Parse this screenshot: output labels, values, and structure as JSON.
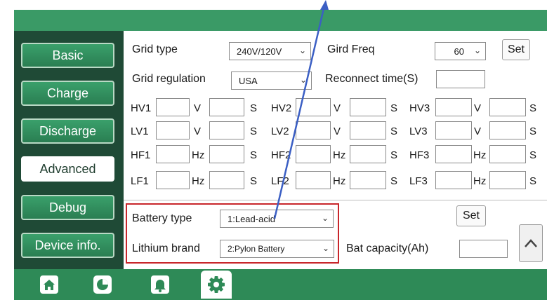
{
  "sidebar": {
    "items": [
      {
        "label": "Basic"
      },
      {
        "label": "Charge"
      },
      {
        "label": "Discharge"
      },
      {
        "label": "Advanced",
        "active": true
      },
      {
        "label": "Debug"
      },
      {
        "label": "Device info."
      }
    ]
  },
  "grid": {
    "type_label": "Grid type",
    "type_value": "240V/120V",
    "freq_label": "Gird Freq",
    "freq_value": "60",
    "set_label": "Set",
    "regulation_label": "Grid regulation",
    "regulation_value": "USA",
    "reconnect_label": "Reconnect time(S)",
    "reconnect_value": ""
  },
  "limits": {
    "unit_v": "V",
    "unit_s": "S",
    "unit_hz": "Hz",
    "hv": [
      "HV1",
      "HV2",
      "HV3"
    ],
    "lv": [
      "LV1",
      "LV2",
      "LV3"
    ],
    "hf": [
      "HF1",
      "HF2",
      "HF3"
    ],
    "lf": [
      "LF1",
      "LF2",
      "LF3"
    ]
  },
  "battery": {
    "type_label": "Battery type",
    "type_value": "1:Lead-acid",
    "brand_label": "Lithium brand",
    "brand_value": "2:Pylon Battery",
    "capacity_label": "Bat capacity(Ah)",
    "capacity_value": "",
    "set_label": "Set"
  },
  "bottom_tabs": [
    {
      "icon": "home-icon"
    },
    {
      "icon": "pie-chart-icon"
    },
    {
      "icon": "bell-icon"
    },
    {
      "icon": "gear-icon",
      "active": true
    }
  ],
  "colors": {
    "frame_green": "#2e8a57",
    "sidebar_dark": "#1f4a36",
    "highlight_red": "#c8262b",
    "arrow_blue": "#3b5fc4"
  }
}
